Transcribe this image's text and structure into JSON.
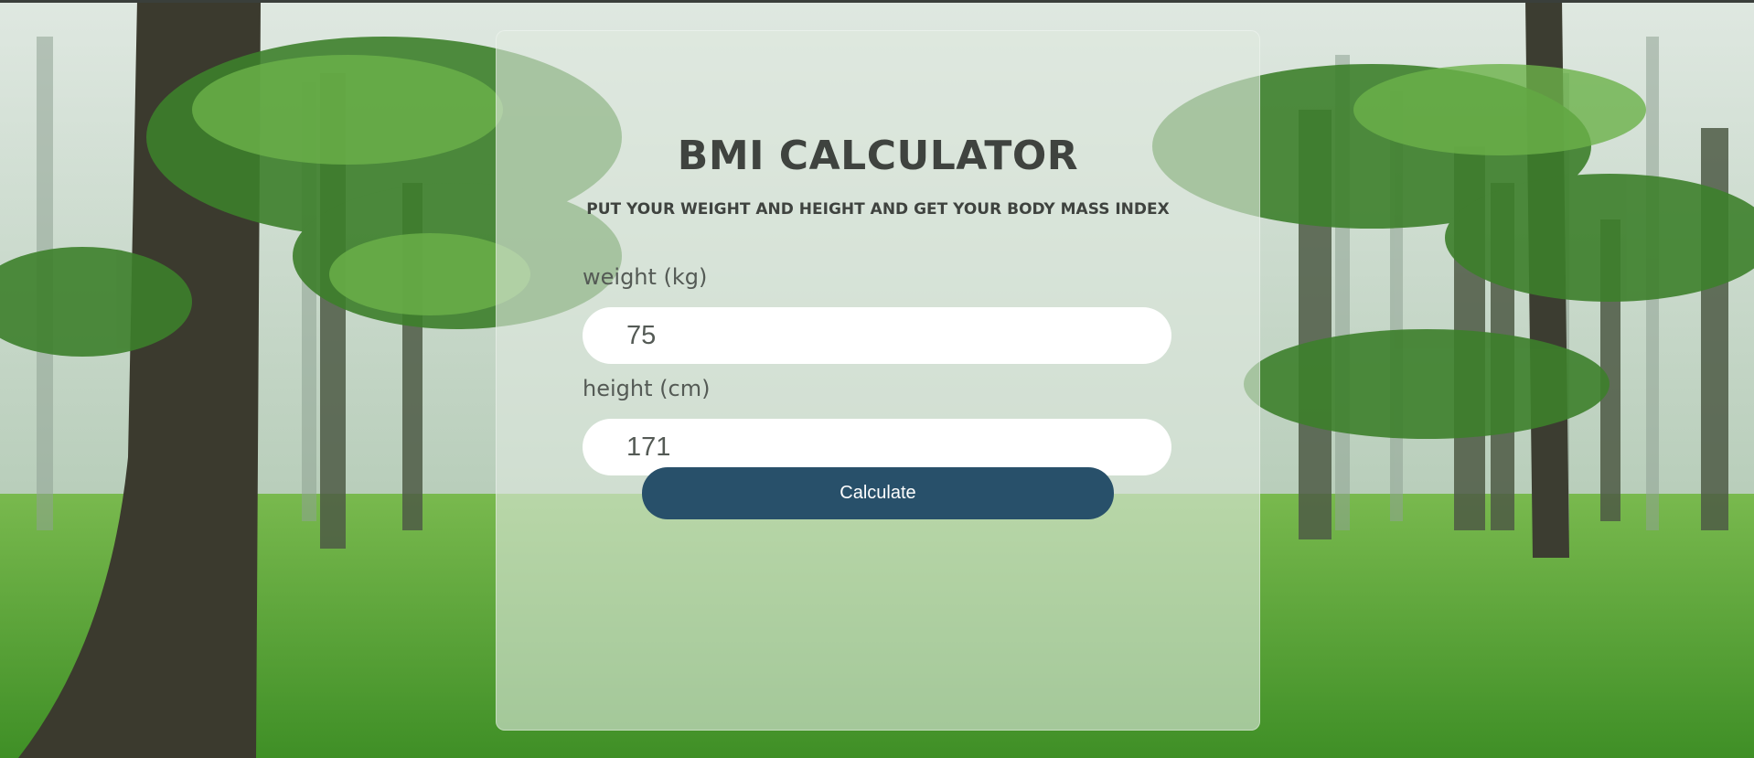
{
  "colors": {
    "card": "#dee8de",
    "text": "#3f433f",
    "button": "#28506a",
    "button_text": "#ffffff",
    "field": "#ffffff"
  },
  "header": {
    "title": "BMI CALCULATOR",
    "subtitle": "PUT YOUR WEIGHT AND HEIGHT AND GET YOUR BODY MASS INDEX"
  },
  "form": {
    "weight": {
      "label": "weight (kg)",
      "value": "75"
    },
    "height": {
      "label": "height (cm)",
      "value": "171"
    },
    "calculate_label": "Calculate"
  }
}
